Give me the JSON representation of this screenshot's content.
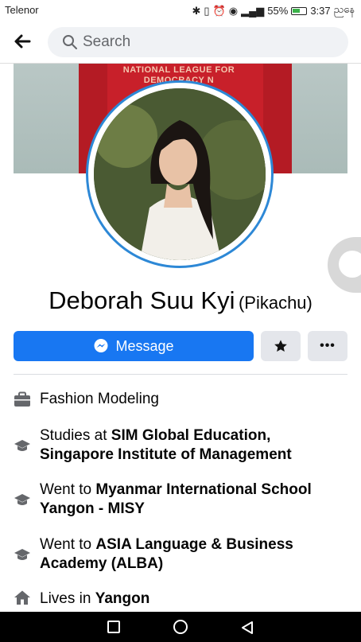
{
  "status_bar": {
    "carrier": "Telenor",
    "battery": "55%",
    "time": "3:37",
    "period": "ညနေ"
  },
  "search": {
    "placeholder": "Search"
  },
  "cover": {
    "jacket_text": "NATIONAL LEAGUE FOR DEMOCRACY N"
  },
  "profile": {
    "name": "Deborah Suu Kyi",
    "nickname": "(Pikachu)"
  },
  "actions": {
    "message_label": "Message",
    "star_icon": "star-icon",
    "more_label": "•••"
  },
  "info": [
    {
      "icon": "briefcase-icon",
      "prefix": "Fashion Modeling",
      "bold": ""
    },
    {
      "icon": "graduation-cap-icon",
      "prefix": "Studies at ",
      "bold": "SIM Global Education, Singapore Institute of Management"
    },
    {
      "icon": "graduation-cap-icon",
      "prefix": "Went to ",
      "bold": "Myanmar International School Yangon - MISY"
    },
    {
      "icon": "graduation-cap-icon",
      "prefix": "Went to ",
      "bold": "ASIA Language & Business Academy (ALBA)"
    },
    {
      "icon": "home-icon",
      "prefix": "Lives in ",
      "bold": "Yangon"
    }
  ],
  "colors": {
    "accent": "#1877f2",
    "ring": "#2d88d6",
    "button_gray": "#e4e6eb"
  }
}
